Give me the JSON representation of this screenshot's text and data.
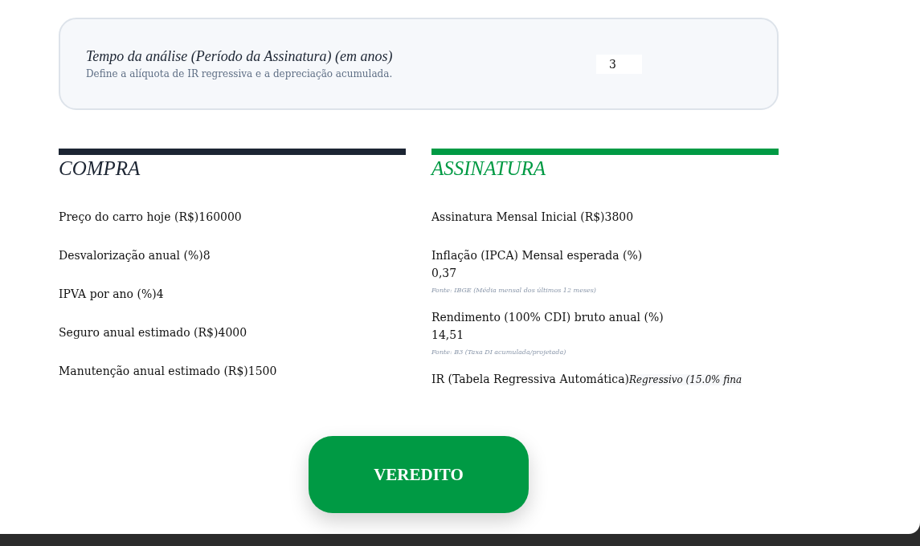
{
  "period": {
    "title": "Tempo da análise (Período da Assinatura) (em anos)",
    "description": "Define a alíquota de IR regressiva e a depreciação acumulada.",
    "value": "3"
  },
  "columns": [
    {
      "title": "COMPRA",
      "color": "#1c2533",
      "fields": [
        {
          "kind": "inline",
          "label": "Preço do carro hoje (R$)",
          "value": "160000"
        },
        {
          "kind": "inline",
          "label": "Desvalorização anual (%)",
          "value": "8"
        },
        {
          "kind": "inline",
          "label": "IPVA por ano (%)",
          "value": "4"
        },
        {
          "kind": "inline",
          "label": "Seguro anual estimado (R$)",
          "value": "4000"
        },
        {
          "kind": "inline",
          "label": "Manutenção anual estimado (R$)",
          "value": "1500"
        }
      ]
    },
    {
      "title": "ASSINATURA",
      "color": "#009a44",
      "fields": [
        {
          "kind": "inline",
          "label": "Assinatura Mensal Inicial (R$)",
          "value": "3800"
        },
        {
          "kind": "stacked",
          "label": "Inflação (IPCA) Mensal esperada (%)",
          "value": "0,37",
          "source": "Fonte: IBGE (Média mensal dos últimos 12 meses)"
        },
        {
          "kind": "stacked",
          "label": "Rendimento (100% CDI) bruto anual (%)",
          "value": "14,51",
          "source": "Fonte: B3 (Taxa DI acumulada/projetada)"
        },
        {
          "kind": "readonly",
          "label": "IR (Tabela Regressiva Automática)",
          "value": "Regressivo (15.0% fina"
        }
      ]
    }
  ],
  "button": {
    "label": "VEREDITO"
  }
}
